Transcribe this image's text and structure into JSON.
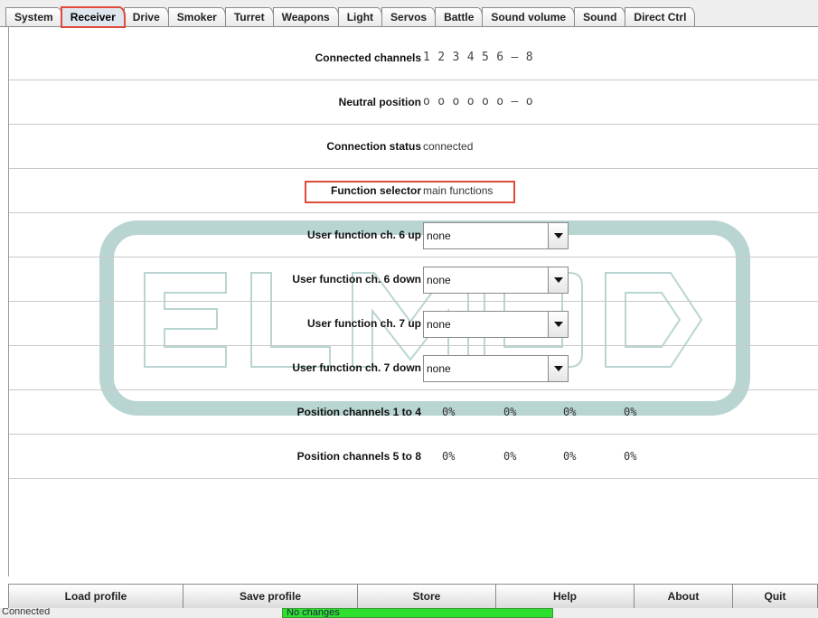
{
  "tabs": [
    {
      "label": "System",
      "selected": false
    },
    {
      "label": "Receiver",
      "selected": true
    },
    {
      "label": "Drive",
      "selected": false
    },
    {
      "label": "Smoker",
      "selected": false
    },
    {
      "label": "Turret",
      "selected": false
    },
    {
      "label": "Weapons",
      "selected": false
    },
    {
      "label": "Light",
      "selected": false
    },
    {
      "label": "Servos",
      "selected": false
    },
    {
      "label": "Battle",
      "selected": false
    },
    {
      "label": "Sound volume",
      "selected": false
    },
    {
      "label": "Sound",
      "selected": false
    },
    {
      "label": "Direct Ctrl",
      "selected": false
    }
  ],
  "receiver": {
    "connected_channels": {
      "label": "Connected channels",
      "value": "1 2 3 4 5 6 – 8"
    },
    "neutral_position": {
      "label": "Neutral position",
      "value": "o o o o o o – o"
    },
    "connection_status": {
      "label": "Connection status",
      "value": "connected"
    },
    "function_selector": {
      "label": "Function selector",
      "value": "main functions"
    },
    "user_functions": [
      {
        "label": "User function ch. 6 up",
        "value": "none"
      },
      {
        "label": "User function ch. 6 down",
        "value": "none"
      },
      {
        "label": "User function ch. 7 up",
        "value": "none"
      },
      {
        "label": "User function ch. 7 down",
        "value": "none"
      }
    ],
    "positions_1_4": {
      "label": "Position channels 1 to 4",
      "values": [
        "0%",
        "0%",
        "0%",
        "0%"
      ]
    },
    "positions_5_8": {
      "label": "Position channels 5 to 8",
      "values": [
        "0%",
        "0%",
        "0%",
        "0%"
      ]
    }
  },
  "buttons": {
    "load_profile": "Load profile",
    "save_profile": "Save profile",
    "store": "Store",
    "help": "Help",
    "about": "About",
    "quit": "Quit"
  },
  "status": {
    "connection": "Connected",
    "changes": "No changes"
  },
  "colors": {
    "highlight": "#e04a3a",
    "watermark": "#7fb3ad",
    "status_green": "#2ee02e"
  },
  "icons": {
    "combo_arrow": "dropdown-arrow-icon",
    "watermark_logo": "elmod-logo"
  }
}
